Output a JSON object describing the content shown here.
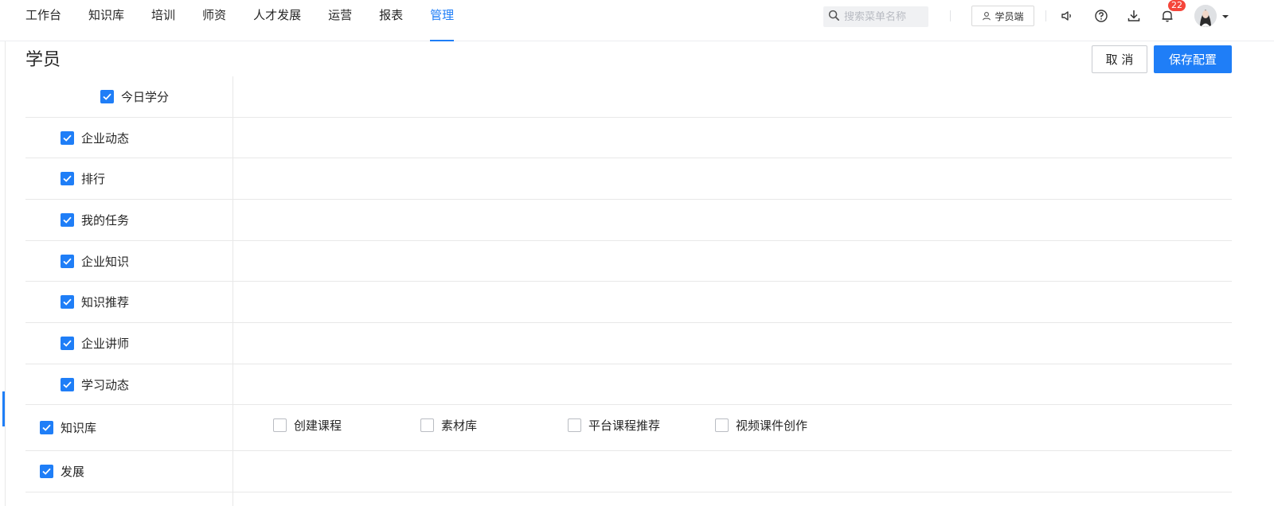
{
  "nav": {
    "items": [
      {
        "label": "工作台",
        "active": false
      },
      {
        "label": "知识库",
        "active": false
      },
      {
        "label": "培训",
        "active": false
      },
      {
        "label": "师资",
        "active": false
      },
      {
        "label": "人才发展",
        "active": false
      },
      {
        "label": "运营",
        "active": false
      },
      {
        "label": "报表",
        "active": false
      },
      {
        "label": "管理",
        "active": true
      }
    ],
    "search_placeholder": "搜索菜单名称",
    "student_button": "学员端",
    "notification_count": "22"
  },
  "page": {
    "title": "学员",
    "cancel_label": "取 消",
    "save_label": "保存配置"
  },
  "rows": [
    {
      "label": "今日学分",
      "checked": true,
      "options": []
    },
    {
      "label": "企业动态",
      "checked": true,
      "options": []
    },
    {
      "label": "排行",
      "checked": true,
      "options": []
    },
    {
      "label": "我的任务",
      "checked": true,
      "options": []
    },
    {
      "label": "企业知识",
      "checked": true,
      "options": []
    },
    {
      "label": "知识推荐",
      "checked": true,
      "options": []
    },
    {
      "label": "企业讲师",
      "checked": true,
      "options": []
    },
    {
      "label": "学习动态",
      "checked": true,
      "options": []
    },
    {
      "label": "知识库",
      "checked": true,
      "options": [
        {
          "label": "创建课程",
          "checked": false
        },
        {
          "label": "素材库",
          "checked": false
        },
        {
          "label": "平台课程推荐",
          "checked": false
        },
        {
          "label": "视频课件创作",
          "checked": false
        }
      ]
    },
    {
      "label": "发展",
      "checked": true,
      "options": []
    }
  ],
  "colors": {
    "accent": "#1f7ef7",
    "badge": "#f5463b",
    "border": "#e8e8e8"
  }
}
